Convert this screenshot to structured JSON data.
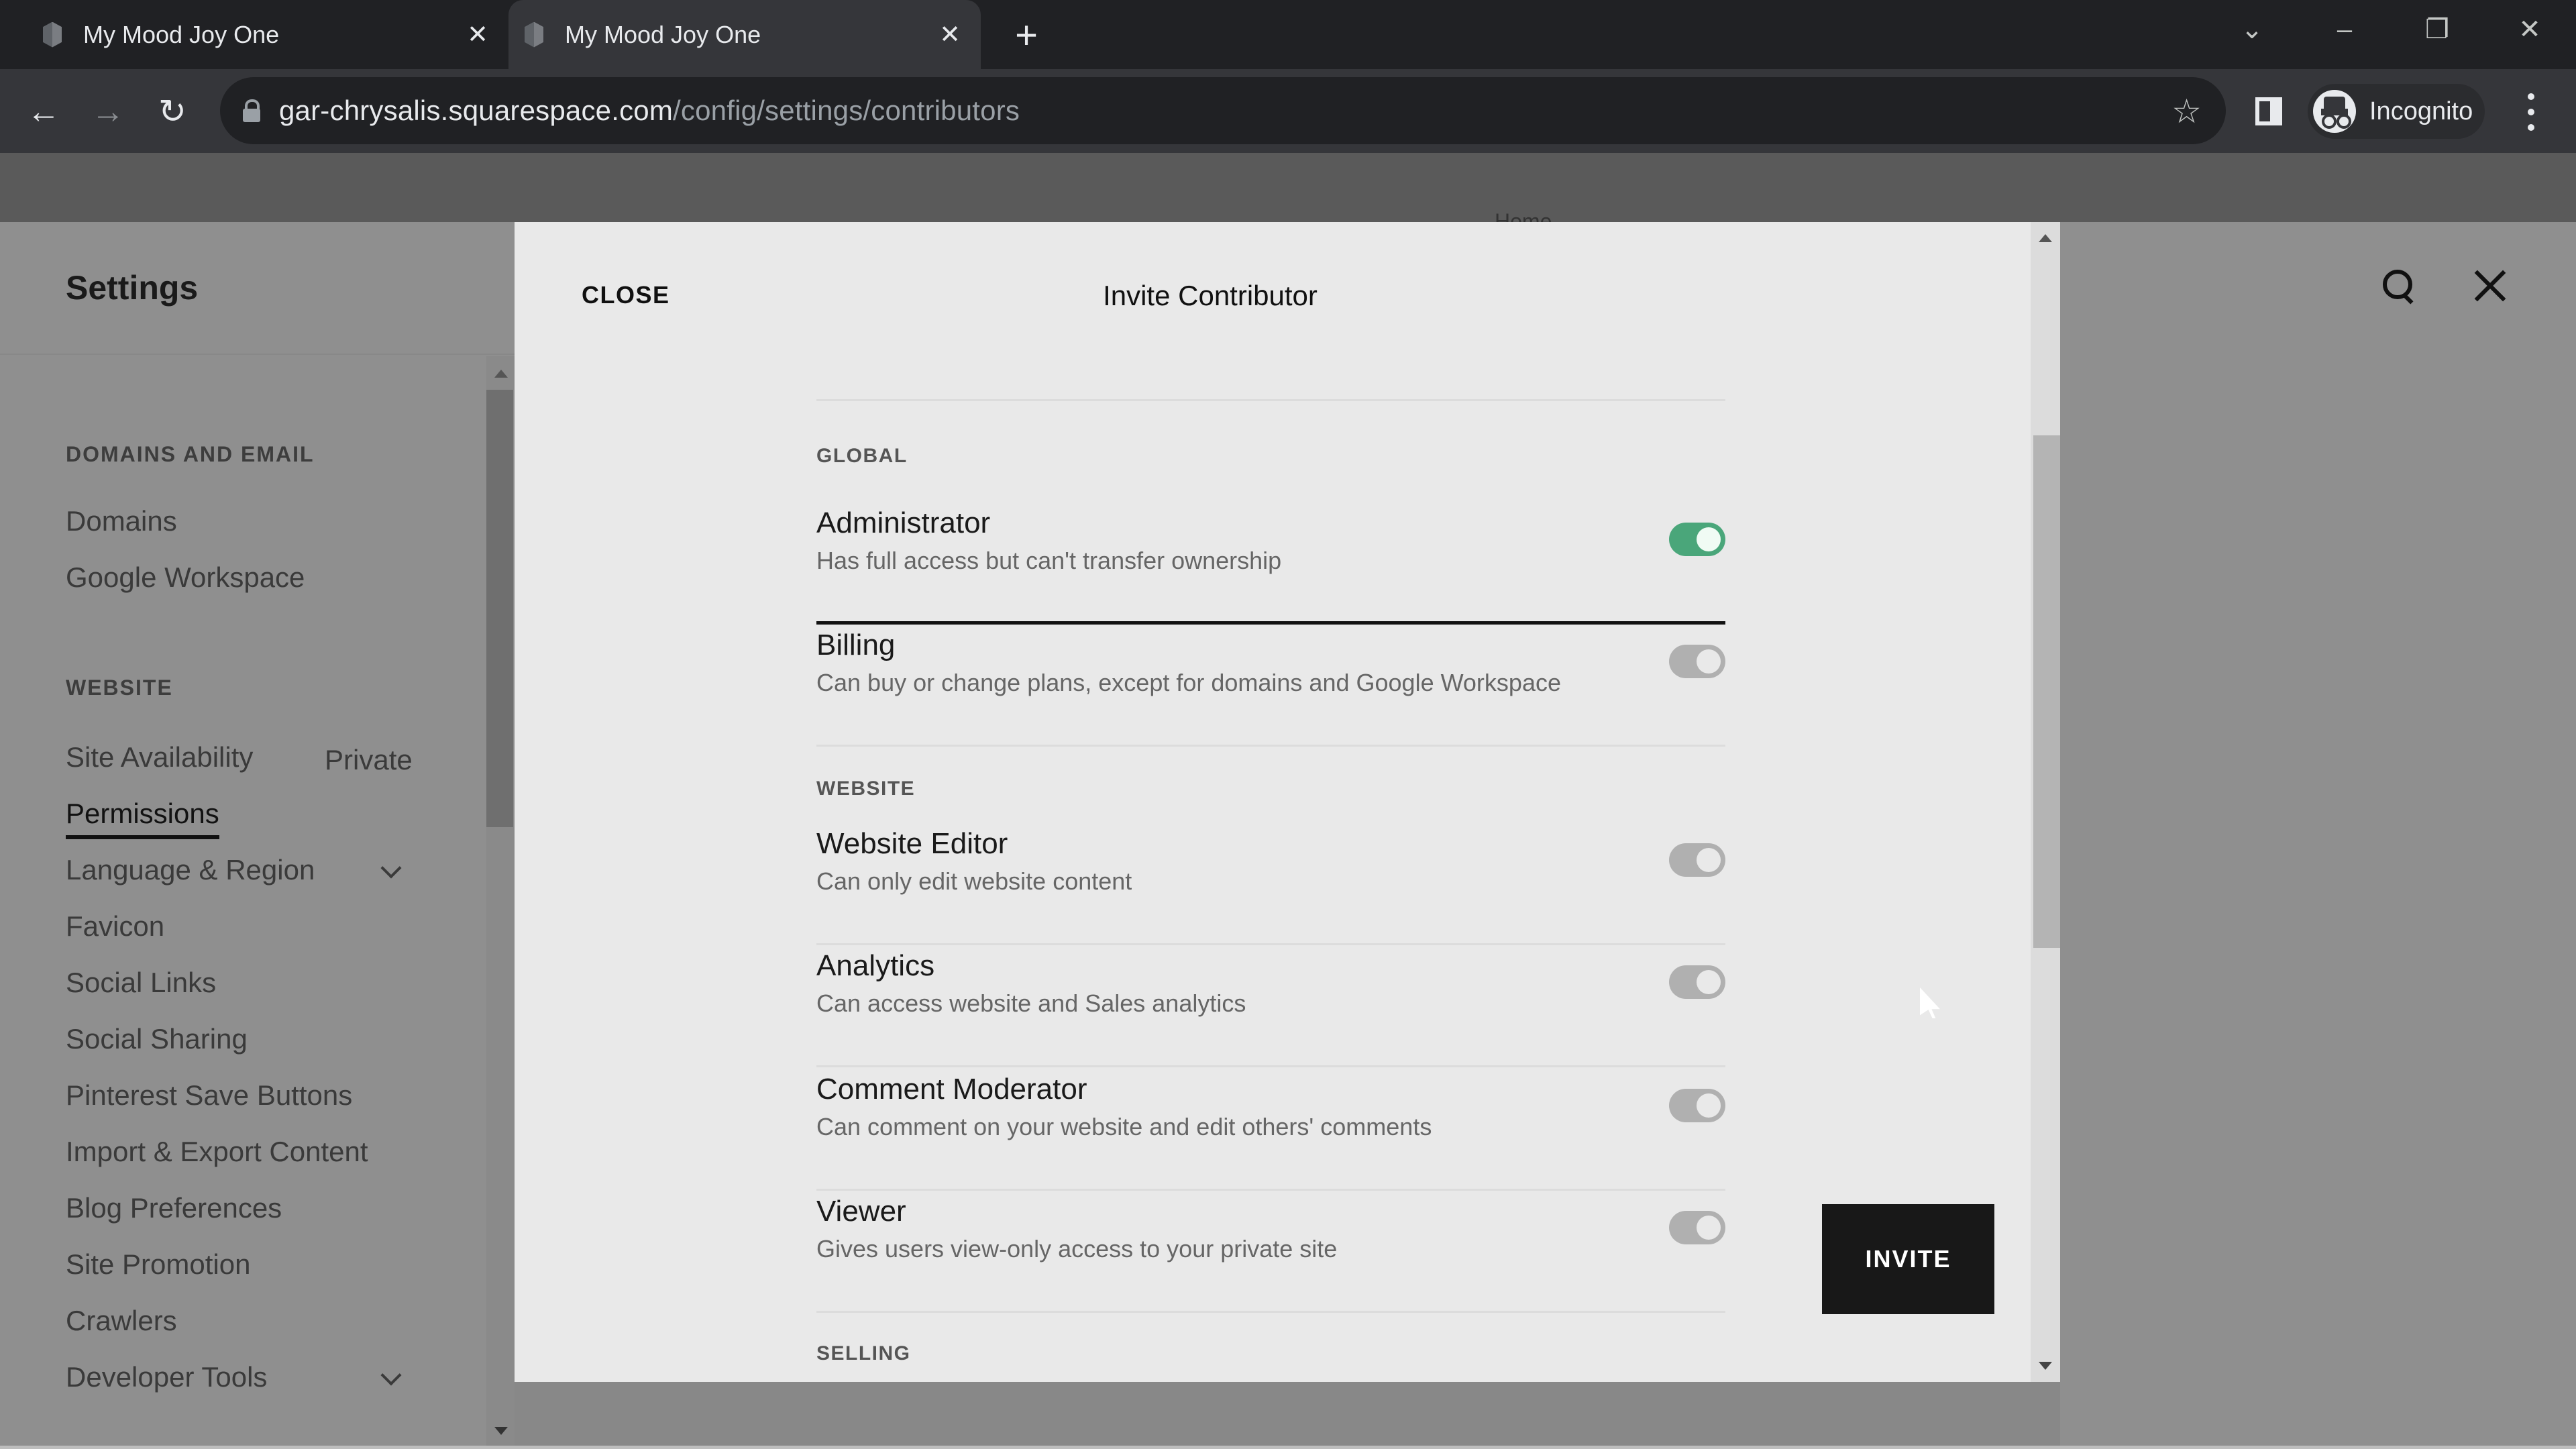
{
  "browser": {
    "tabs": [
      {
        "title": "My Mood Joy One",
        "active": false
      },
      {
        "title": "My Mood Joy One",
        "active": true
      }
    ],
    "new_tab_symbol": "+",
    "close_tab_symbol": "✕",
    "url_host": "gar-chrysalis.squarespace.com",
    "url_path": "/config/settings/contributors",
    "profile_label": "Incognito",
    "icons": {
      "back": "←",
      "forward": "→",
      "reload": "↻",
      "star": "☆",
      "tab_search": "⌄",
      "minimize": "–",
      "restore": "❐",
      "close": "✕"
    }
  },
  "page": {
    "behind_modal_label": "Home",
    "sidebar_title": "Settings",
    "sidebar": {
      "sections": [
        {
          "heading": "DOMAINS AND EMAIL",
          "items": [
            {
              "label": "Domains"
            },
            {
              "label": "Google Workspace"
            }
          ]
        },
        {
          "heading": "WEBSITE",
          "items": [
            {
              "label": "Site Availability",
              "value": "Private"
            },
            {
              "label": "Permissions",
              "active": true
            },
            {
              "label": "Language & Region",
              "expandable": true
            },
            {
              "label": "Favicon"
            },
            {
              "label": "Social Links"
            },
            {
              "label": "Social Sharing"
            },
            {
              "label": "Pinterest Save Buttons"
            },
            {
              "label": "Import & Export Content"
            },
            {
              "label": "Blog Preferences"
            },
            {
              "label": "Site Promotion"
            },
            {
              "label": "Crawlers"
            },
            {
              "label": "Developer Tools",
              "expandable": true
            }
          ]
        }
      ]
    }
  },
  "modal": {
    "close_label": "CLOSE",
    "title": "Invite Contributor",
    "sections": [
      {
        "heading": "GLOBAL",
        "permissions": [
          {
            "name": "Administrator",
            "description": "Has full access but can't transfer ownership",
            "enabled": true
          },
          {
            "name": "Billing",
            "description": "Can buy or change plans, except for domains and Google Workspace",
            "enabled": false
          }
        ]
      },
      {
        "heading": "WEBSITE",
        "permissions": [
          {
            "name": "Website Editor",
            "description": "Can only edit website content",
            "enabled": false
          },
          {
            "name": "Analytics",
            "description": "Can access website and Sales analytics",
            "enabled": false
          },
          {
            "name": "Comment Moderator",
            "description": "Can comment on your website and edit others' comments",
            "enabled": false
          },
          {
            "name": "Viewer",
            "description": "Gives users view-only access to your private site",
            "enabled": false
          }
        ]
      },
      {
        "heading": "SELLING",
        "permissions": []
      }
    ],
    "invite_label": "INVITE"
  },
  "colors": {
    "toggle_on": "#4aa67a",
    "toggle_off_disabled": "#b0b0b0",
    "invite_button": "#181818"
  }
}
